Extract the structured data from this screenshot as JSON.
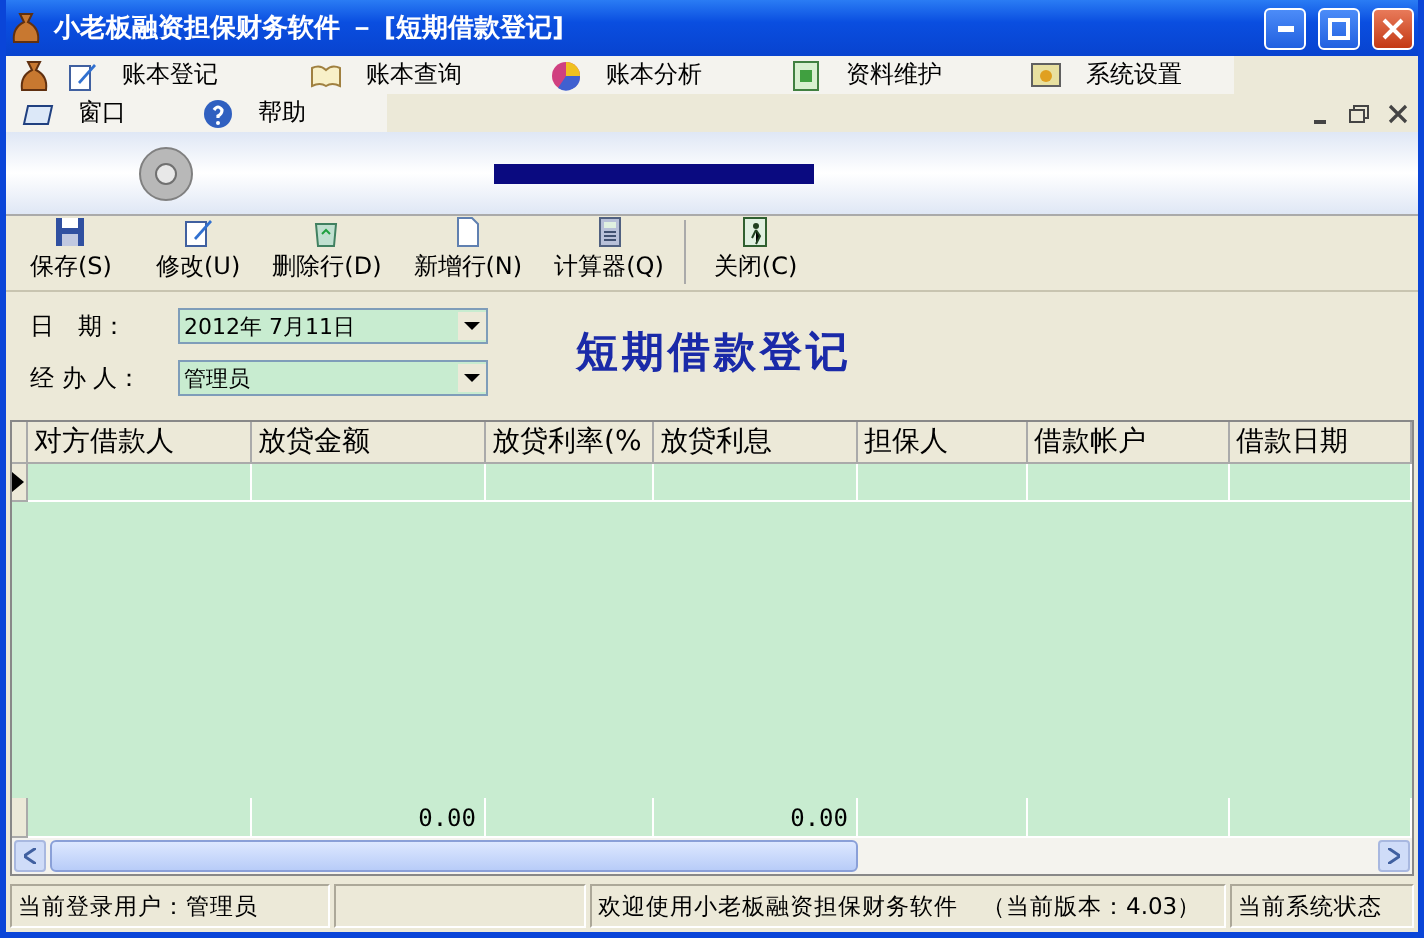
{
  "window": {
    "title": "小老板融资担保财务软件 － [短期借款登记]"
  },
  "menu_bar": [
    {
      "label": "账本登记"
    },
    {
      "label": "账本查询"
    },
    {
      "label": "账本分析"
    },
    {
      "label": "资料维护"
    },
    {
      "label": "系统设置"
    }
  ],
  "menu_bar_2": [
    {
      "label": "窗口"
    },
    {
      "label": "帮助"
    }
  ],
  "toolbar": [
    {
      "label": "保存(S)"
    },
    {
      "label": "修改(U)"
    },
    {
      "label": "删除行(D)"
    },
    {
      "label": "新增行(N)"
    },
    {
      "label": "计算器(Q)"
    },
    {
      "label": "关闭(C)"
    }
  ],
  "form": {
    "date_label": "日　期：",
    "date_value": "2012年 7月11日",
    "handler_label": "经 办 人：",
    "handler_value": "管理员",
    "heading": "短期借款登记"
  },
  "table": {
    "columns": [
      "对方借款人",
      "放贷金额",
      "放贷利率(%",
      "放贷利息",
      "担保人",
      "借款帐户",
      "借款日期"
    ],
    "rows": [
      {
        "current": true
      }
    ],
    "totals": {
      "loan_amount": "0.00",
      "loan_interest": "0.00"
    }
  },
  "status_bar": {
    "user": "当前登录用户：管理员",
    "message": "欢迎使用小老板融资担保财务软件　（当前版本：4.03）",
    "state": "当前系统状态"
  }
}
